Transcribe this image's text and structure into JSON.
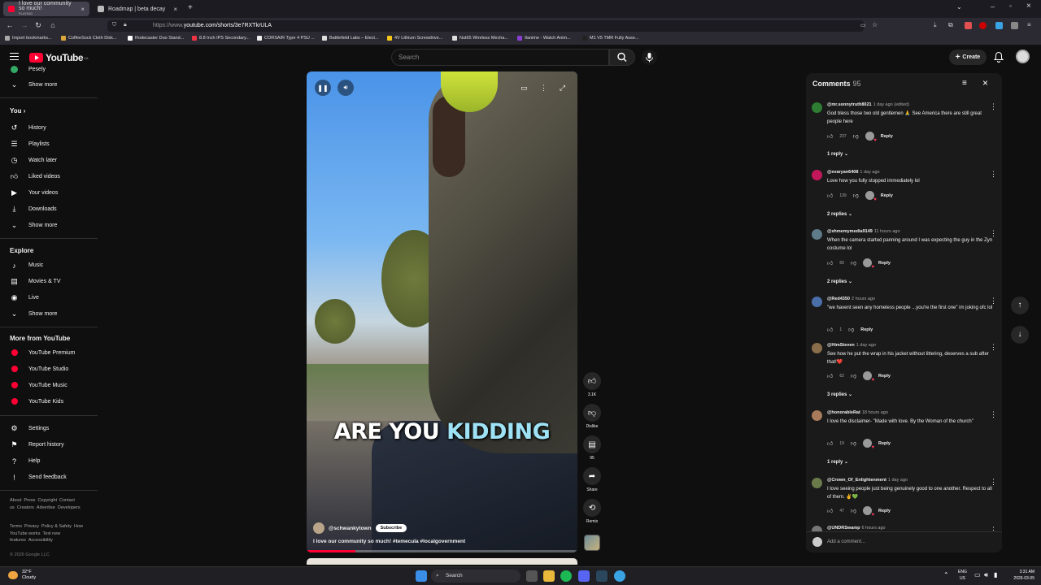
{
  "browser": {
    "tabs": [
      {
        "title": "I love our community so much!",
        "subtitle": "PLAYING",
        "active": true
      },
      {
        "title": "Roadmap | beta decay",
        "active": false
      }
    ],
    "url_scheme": "https://www.",
    "url_rest": "youtube.com/shorts/3e7RXTkrULA",
    "bookmarks": [
      "Import bookmarks...",
      "CoffeeSock Cloth Disk...",
      "Rodecaster Duo Stand...",
      "8.8 Inch IPS Secondary...",
      "CORSAIR Type 4 PSU ...",
      "Battlefield Labs – Elect...",
      "4V Lithium Screwdrive...",
      "Nut65 Wireless Mecha...",
      "9anime - Watch Anim...",
      "M1 V5 TMR Fully Asse..."
    ]
  },
  "header": {
    "logo": "YouTube",
    "region": "CA",
    "search_placeholder": "Search",
    "create": "Create"
  },
  "sidebar": {
    "top_item": "Pesely",
    "show_more_1": "Show more",
    "you_heading": "You",
    "you_items": [
      "History",
      "Playlists",
      "Watch later",
      "Liked videos",
      "Your videos",
      "Downloads",
      "Show more"
    ],
    "explore_heading": "Explore",
    "explore_items": [
      "Music",
      "Movies & TV",
      "Live",
      "Show more"
    ],
    "more_heading": "More from YouTube",
    "more_items": [
      "YouTube Premium",
      "YouTube Studio",
      "YouTube Music",
      "YouTube Kids"
    ],
    "settings_items": [
      "Settings",
      "Report history",
      "Help",
      "Send feedback"
    ],
    "footer_1": [
      "About",
      "Press",
      "Copyright",
      "Contact us",
      "Creators",
      "Advertise",
      "Developers"
    ],
    "footer_2": [
      "Terms",
      "Privacy",
      "Policy & Safety",
      "How YouTube works",
      "Test new features",
      "Accessibility"
    ],
    "copyright": "© 2026 Google LLC"
  },
  "video": {
    "caption_1": "ARE YOU",
    "caption_2": "KIDDING",
    "channel": "@schwankytown",
    "subscribe": "Subscribe",
    "title": "I love our community so much! #temecula #localgovernment",
    "progress": 0.18
  },
  "actions": {
    "likes": "3.1K",
    "dislike": "Dislike",
    "comments": "95",
    "share": "Share",
    "remix": "Remix"
  },
  "comments": {
    "heading": "Comments",
    "count": "95",
    "add_placeholder": "Add a comment...",
    "items": [
      {
        "author": "@mr.sonnytruth8021",
        "time": "1 day ago (edited)",
        "text": "God bless those two old gentlemen 🙏 See America there are still great people here",
        "likes": "237",
        "reply": "Reply",
        "replies": "1 reply",
        "color": "#2e7d32"
      },
      {
        "author": "@evaryan6408",
        "time": "1 day ago",
        "text": "Love how you fully stopped immediately lol",
        "likes": "139",
        "reply": "Reply",
        "replies": "2 replies",
        "color": "#c2185b"
      },
      {
        "author": "@shmemymedia9149",
        "time": "11 hours ago",
        "text": "When the camera started panning around I was expecting the guy in the Zyn costume lol",
        "likes": "60",
        "reply": "Reply",
        "replies": "2 replies",
        "color": "#5f7b8a"
      },
      {
        "author": "@Red4350",
        "time": "2 hours ago",
        "text": "\"we havent seen any homeless people ...you're the first one\" im joking ofc lol",
        "likes": "1",
        "reply": "Reply",
        "replies": "",
        "color": "#4a6ea8"
      },
      {
        "author": "@HimSteven",
        "time": "1 day ago",
        "text": "See how he put the wrap in his jacket without littering, deserves a sub after that!❤️",
        "likes": "62",
        "reply": "Reply",
        "replies": "3 replies",
        "color": "#8a6d4a"
      },
      {
        "author": "@honorableRat",
        "time": "18 hours ago",
        "text": "I love the disclaimer- \"Made with love. By the Woman of the church\"",
        "likes": "19",
        "reply": "Reply",
        "replies": "1 reply",
        "color": "#a87b5a"
      },
      {
        "author": "@Crown_Of_Enlightenment",
        "time": "1 day ago",
        "text": "I love seeing people just being genuinely good to one another. Respect to all of them. ✌️💚",
        "likes": "47",
        "reply": "Reply",
        "replies": "",
        "color": "#6a7a4a"
      },
      {
        "author": "@UNDRSwamp",
        "time": "6 hours ago",
        "text": "",
        "likes": "",
        "reply": "",
        "replies": "",
        "color": "#777777"
      }
    ]
  },
  "taskbar": {
    "temp": "32°F",
    "weather": "Cloudy",
    "search": "Search",
    "lang_1": "ENG",
    "lang_2": "US",
    "time": "3:31 AM",
    "date": "2026-03-05"
  }
}
